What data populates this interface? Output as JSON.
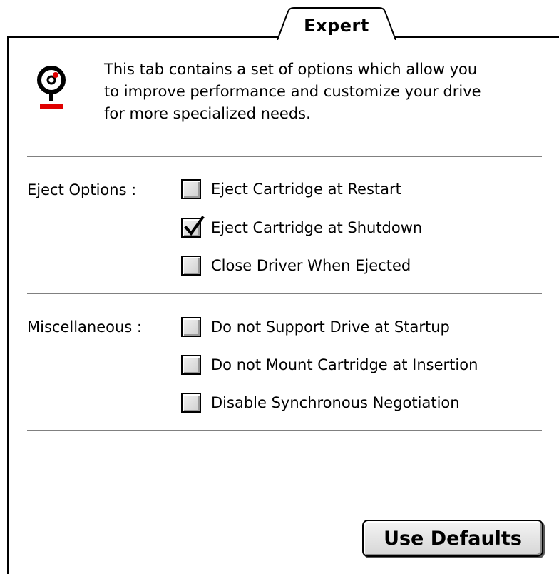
{
  "tab": {
    "label": "Expert"
  },
  "intro": {
    "icon": "drive-icon",
    "text_lines": [
      "This tab contains a set of options which allow you",
      "to improve performance and customize your drive",
      "for more specialized needs."
    ]
  },
  "eject_options": {
    "label": "Eject Options :",
    "items": [
      {
        "label": "Eject Cartridge at Restart",
        "checked": false
      },
      {
        "label": "Eject Cartridge at Shutdown",
        "checked": true
      },
      {
        "label": "Close Driver When Ejected",
        "checked": false
      }
    ]
  },
  "miscellaneous": {
    "label": "Miscellaneous :",
    "items": [
      {
        "label": "Do not Support Drive at Startup",
        "checked": false
      },
      {
        "label": "Do not Mount Cartridge at Insertion",
        "checked": false
      },
      {
        "label": "Disable Synchronous Negotiation",
        "checked": false
      }
    ]
  },
  "buttons": {
    "use_defaults": "Use Defaults"
  },
  "colors": {
    "icon_accent": "#e00000",
    "divider": "#808080"
  }
}
